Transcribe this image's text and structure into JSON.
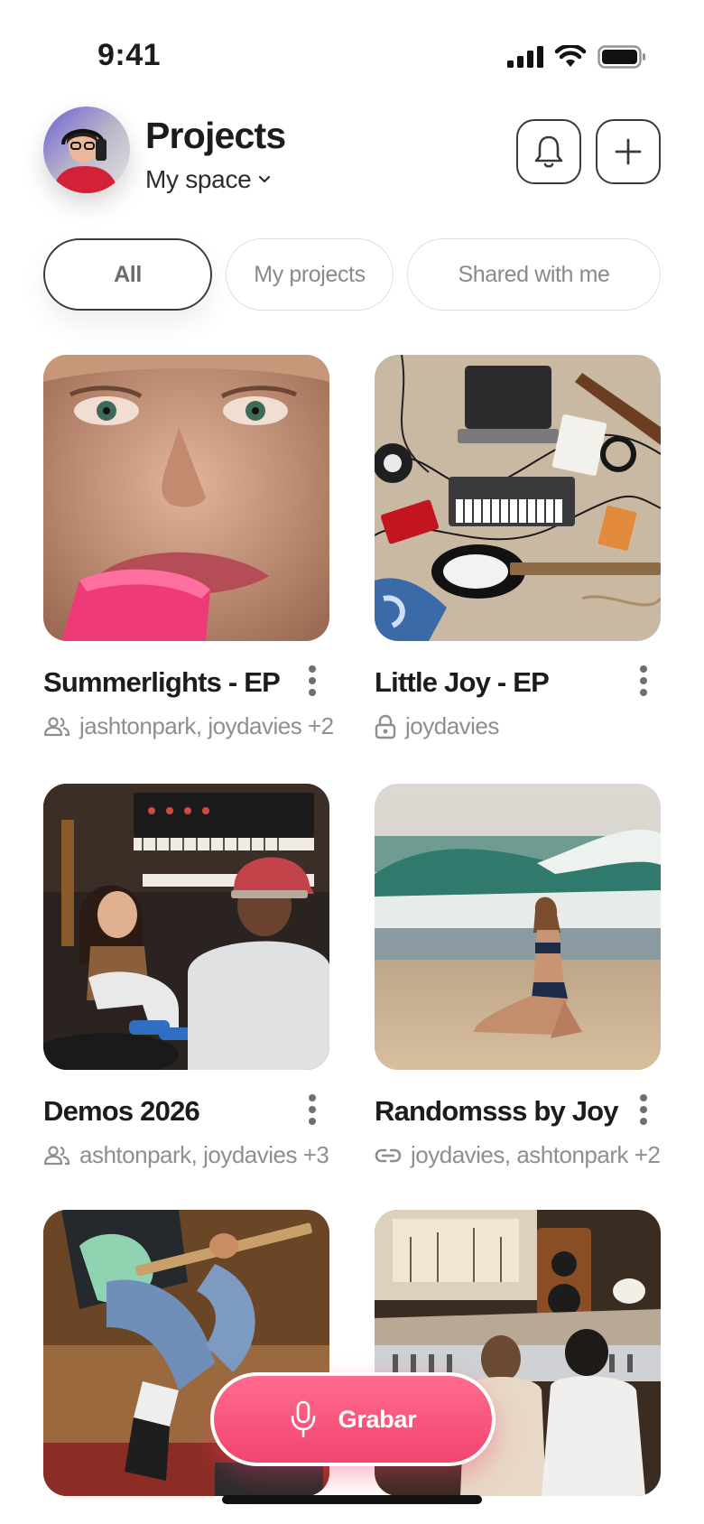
{
  "status_bar": {
    "time": "9:41"
  },
  "header": {
    "title": "Projects",
    "space_label": "My space"
  },
  "tabs": [
    {
      "label": "All",
      "selected": true
    },
    {
      "label": "My projects",
      "selected": false
    },
    {
      "label": "Shared with me",
      "selected": false
    }
  ],
  "projects": [
    {
      "title": "Summerlights - EP",
      "meta_icon": "people-icon",
      "meta": "jashtonpark, joydavies +2"
    },
    {
      "title": "Little Joy - EP",
      "meta_icon": "lock-icon",
      "meta": "joydavies"
    },
    {
      "title": "Demos 2026",
      "meta_icon": "people-icon",
      "meta": "ashtonpark, joydavies +3"
    },
    {
      "title": "Randomsss by Joy",
      "meta_icon": "link-icon",
      "meta": "joydavies, ashtonpark +2"
    },
    {
      "title": "",
      "meta_icon": "",
      "meta": ""
    },
    {
      "title": "",
      "meta_icon": "",
      "meta": ""
    }
  ],
  "record_button": {
    "label": "Grabar"
  },
  "colors": {
    "accent": "#f2456f",
    "text": "#1c1c1e",
    "muted": "#8e8e93"
  }
}
